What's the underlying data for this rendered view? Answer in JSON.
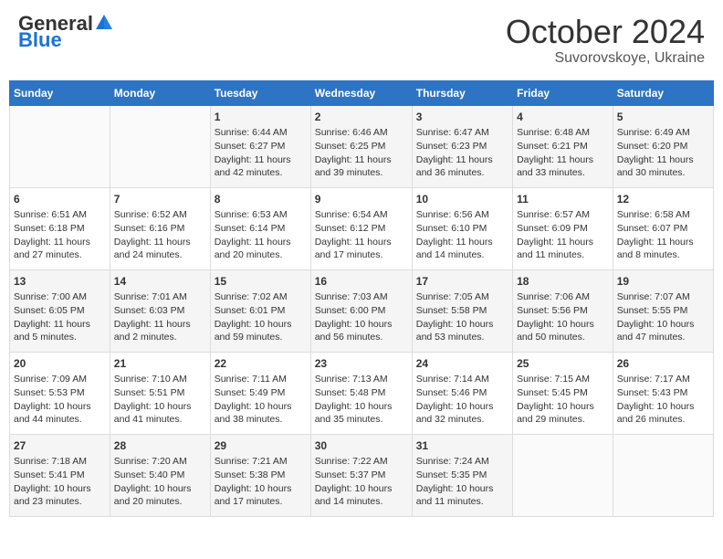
{
  "header": {
    "logo_general": "General",
    "logo_blue": "Blue",
    "month": "October 2024",
    "location": "Suvorovskoye, Ukraine"
  },
  "weekdays": [
    "Sunday",
    "Monday",
    "Tuesday",
    "Wednesday",
    "Thursday",
    "Friday",
    "Saturday"
  ],
  "weeks": [
    [
      {
        "day": "",
        "text": ""
      },
      {
        "day": "",
        "text": ""
      },
      {
        "day": "1",
        "text": "Sunrise: 6:44 AM\nSunset: 6:27 PM\nDaylight: 11 hours and 42 minutes."
      },
      {
        "day": "2",
        "text": "Sunrise: 6:46 AM\nSunset: 6:25 PM\nDaylight: 11 hours and 39 minutes."
      },
      {
        "day": "3",
        "text": "Sunrise: 6:47 AM\nSunset: 6:23 PM\nDaylight: 11 hours and 36 minutes."
      },
      {
        "day": "4",
        "text": "Sunrise: 6:48 AM\nSunset: 6:21 PM\nDaylight: 11 hours and 33 minutes."
      },
      {
        "day": "5",
        "text": "Sunrise: 6:49 AM\nSunset: 6:20 PM\nDaylight: 11 hours and 30 minutes."
      }
    ],
    [
      {
        "day": "6",
        "text": "Sunrise: 6:51 AM\nSunset: 6:18 PM\nDaylight: 11 hours and 27 minutes."
      },
      {
        "day": "7",
        "text": "Sunrise: 6:52 AM\nSunset: 6:16 PM\nDaylight: 11 hours and 24 minutes."
      },
      {
        "day": "8",
        "text": "Sunrise: 6:53 AM\nSunset: 6:14 PM\nDaylight: 11 hours and 20 minutes."
      },
      {
        "day": "9",
        "text": "Sunrise: 6:54 AM\nSunset: 6:12 PM\nDaylight: 11 hours and 17 minutes."
      },
      {
        "day": "10",
        "text": "Sunrise: 6:56 AM\nSunset: 6:10 PM\nDaylight: 11 hours and 14 minutes."
      },
      {
        "day": "11",
        "text": "Sunrise: 6:57 AM\nSunset: 6:09 PM\nDaylight: 11 hours and 11 minutes."
      },
      {
        "day": "12",
        "text": "Sunrise: 6:58 AM\nSunset: 6:07 PM\nDaylight: 11 hours and 8 minutes."
      }
    ],
    [
      {
        "day": "13",
        "text": "Sunrise: 7:00 AM\nSunset: 6:05 PM\nDaylight: 11 hours and 5 minutes."
      },
      {
        "day": "14",
        "text": "Sunrise: 7:01 AM\nSunset: 6:03 PM\nDaylight: 11 hours and 2 minutes."
      },
      {
        "day": "15",
        "text": "Sunrise: 7:02 AM\nSunset: 6:01 PM\nDaylight: 10 hours and 59 minutes."
      },
      {
        "day": "16",
        "text": "Sunrise: 7:03 AM\nSunset: 6:00 PM\nDaylight: 10 hours and 56 minutes."
      },
      {
        "day": "17",
        "text": "Sunrise: 7:05 AM\nSunset: 5:58 PM\nDaylight: 10 hours and 53 minutes."
      },
      {
        "day": "18",
        "text": "Sunrise: 7:06 AM\nSunset: 5:56 PM\nDaylight: 10 hours and 50 minutes."
      },
      {
        "day": "19",
        "text": "Sunrise: 7:07 AM\nSunset: 5:55 PM\nDaylight: 10 hours and 47 minutes."
      }
    ],
    [
      {
        "day": "20",
        "text": "Sunrise: 7:09 AM\nSunset: 5:53 PM\nDaylight: 10 hours and 44 minutes."
      },
      {
        "day": "21",
        "text": "Sunrise: 7:10 AM\nSunset: 5:51 PM\nDaylight: 10 hours and 41 minutes."
      },
      {
        "day": "22",
        "text": "Sunrise: 7:11 AM\nSunset: 5:49 PM\nDaylight: 10 hours and 38 minutes."
      },
      {
        "day": "23",
        "text": "Sunrise: 7:13 AM\nSunset: 5:48 PM\nDaylight: 10 hours and 35 minutes."
      },
      {
        "day": "24",
        "text": "Sunrise: 7:14 AM\nSunset: 5:46 PM\nDaylight: 10 hours and 32 minutes."
      },
      {
        "day": "25",
        "text": "Sunrise: 7:15 AM\nSunset: 5:45 PM\nDaylight: 10 hours and 29 minutes."
      },
      {
        "day": "26",
        "text": "Sunrise: 7:17 AM\nSunset: 5:43 PM\nDaylight: 10 hours and 26 minutes."
      }
    ],
    [
      {
        "day": "27",
        "text": "Sunrise: 7:18 AM\nSunset: 5:41 PM\nDaylight: 10 hours and 23 minutes."
      },
      {
        "day": "28",
        "text": "Sunrise: 7:20 AM\nSunset: 5:40 PM\nDaylight: 10 hours and 20 minutes."
      },
      {
        "day": "29",
        "text": "Sunrise: 7:21 AM\nSunset: 5:38 PM\nDaylight: 10 hours and 17 minutes."
      },
      {
        "day": "30",
        "text": "Sunrise: 7:22 AM\nSunset: 5:37 PM\nDaylight: 10 hours and 14 minutes."
      },
      {
        "day": "31",
        "text": "Sunrise: 7:24 AM\nSunset: 5:35 PM\nDaylight: 10 hours and 11 minutes."
      },
      {
        "day": "",
        "text": ""
      },
      {
        "day": "",
        "text": ""
      }
    ]
  ]
}
